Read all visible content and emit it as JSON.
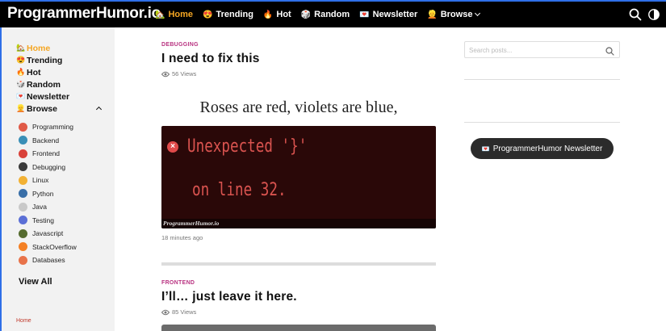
{
  "site": {
    "logo": "ProgrammerHumor.io"
  },
  "nav": [
    {
      "emoji": "🏡",
      "label": "Home",
      "active": true
    },
    {
      "emoji": "😍",
      "label": "Trending"
    },
    {
      "emoji": "🔥",
      "label": "Hot"
    },
    {
      "emoji": "🎲",
      "label": "Random"
    },
    {
      "emoji": "💌",
      "label": "Newsletter"
    },
    {
      "emoji": "👱",
      "label": "Browse"
    }
  ],
  "sidebar": {
    "main": [
      {
        "emoji": "🏡",
        "label": "Home"
      },
      {
        "emoji": "😍",
        "label": "Trending"
      },
      {
        "emoji": "🔥",
        "label": "Hot"
      },
      {
        "emoji": "🎲",
        "label": "Random"
      },
      {
        "emoji": "💌",
        "label": "Newsletter"
      },
      {
        "emoji": "👱",
        "label": "Browse"
      }
    ],
    "categories": [
      {
        "label": "Programming",
        "color": "#e05a47"
      },
      {
        "label": "Backend",
        "color": "#3a8fb7"
      },
      {
        "label": "Frontend",
        "color": "#d9423a"
      },
      {
        "label": "Debugging",
        "color": "#3b3b3b"
      },
      {
        "label": "Linux",
        "color": "#f2b134"
      },
      {
        "label": "Python",
        "color": "#3a6fa8"
      },
      {
        "label": "Java",
        "color": "#c9c9c9"
      },
      {
        "label": "Testing",
        "color": "#5b6fd6"
      },
      {
        "label": "Javascript",
        "color": "#556b2f"
      },
      {
        "label": "StackOverflow",
        "color": "#f48024"
      },
      {
        "label": "Databases",
        "color": "#e8734a"
      }
    ],
    "view_all": "View All",
    "footer": "Home"
  },
  "posts": [
    {
      "category": "DEBUGGING",
      "title": "I need to fix this",
      "views": "56 Views",
      "image_text_top": "Roses are red, violets are blue,",
      "image_text_line1": "Unexpected '}'",
      "image_text_line2": "on line 32.",
      "image_watermark": "ProgrammerHumor.io",
      "time": "18 minutes ago"
    },
    {
      "category": "FRONTEND",
      "title": "I’ll… just leave it here.",
      "views": "85 Views"
    }
  ],
  "right": {
    "search_placeholder": "Search posts...",
    "newsletter_emoji": "💌",
    "newsletter_label": "ProgrammerHumor Newsletter"
  }
}
